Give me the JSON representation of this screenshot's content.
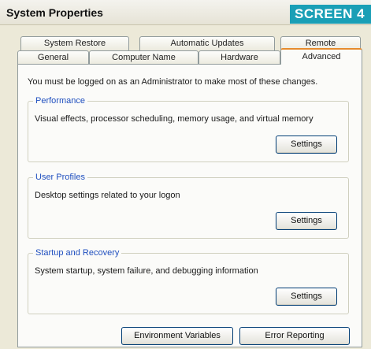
{
  "window": {
    "title": "System Properties",
    "badge": "SCREEN 4"
  },
  "tabs": {
    "row_back": [
      "System Restore",
      "Automatic Updates",
      "Remote"
    ],
    "row_front": [
      "General",
      "Computer Name",
      "Hardware",
      "Advanced"
    ],
    "selected": "Advanced"
  },
  "advanced": {
    "intro": "You must be logged on as an Administrator to make most of these changes.",
    "performance": {
      "legend": "Performance",
      "description": "Visual effects, processor scheduling, memory usage, and virtual memory",
      "button": "Settings"
    },
    "user_profiles": {
      "legend": "User Profiles",
      "description": "Desktop settings related to your logon",
      "button": "Settings"
    },
    "startup_recovery": {
      "legend": "Startup and Recovery",
      "description": "System startup, system failure, and debugging information",
      "button": "Settings"
    },
    "environment_button": "Environment Variables",
    "error_reporting_button": "Error Reporting"
  },
  "colors": {
    "legend_text": "#1f4fbf",
    "selected_tab_accent": "#e68b2c",
    "badge_background": "#1a9fb6"
  }
}
